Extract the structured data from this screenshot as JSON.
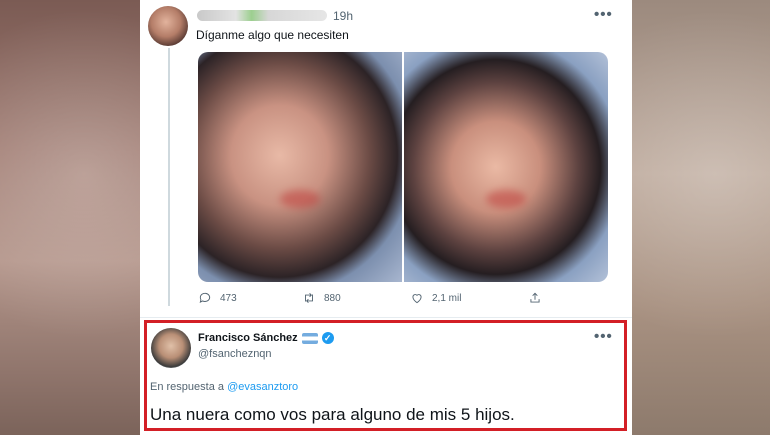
{
  "tweet": {
    "time": "19h",
    "more": "•••",
    "text": "Díganme algo que necesiten",
    "actions": {
      "replies": "473",
      "retweets": "880",
      "likes": "2,1 mil"
    }
  },
  "reply": {
    "name": "Francisco Sánchez",
    "handle": "@fsancheznqn",
    "more": "•••",
    "in_reply_prefix": "En respuesta a",
    "in_reply_to": "@evasanztoro",
    "text": "Una nuera como vos para alguno de mis 5 hijos."
  },
  "colors": {
    "highlight_border": "#d31f26",
    "link": "#1d9bf0",
    "verified": "#1d9bf0"
  }
}
